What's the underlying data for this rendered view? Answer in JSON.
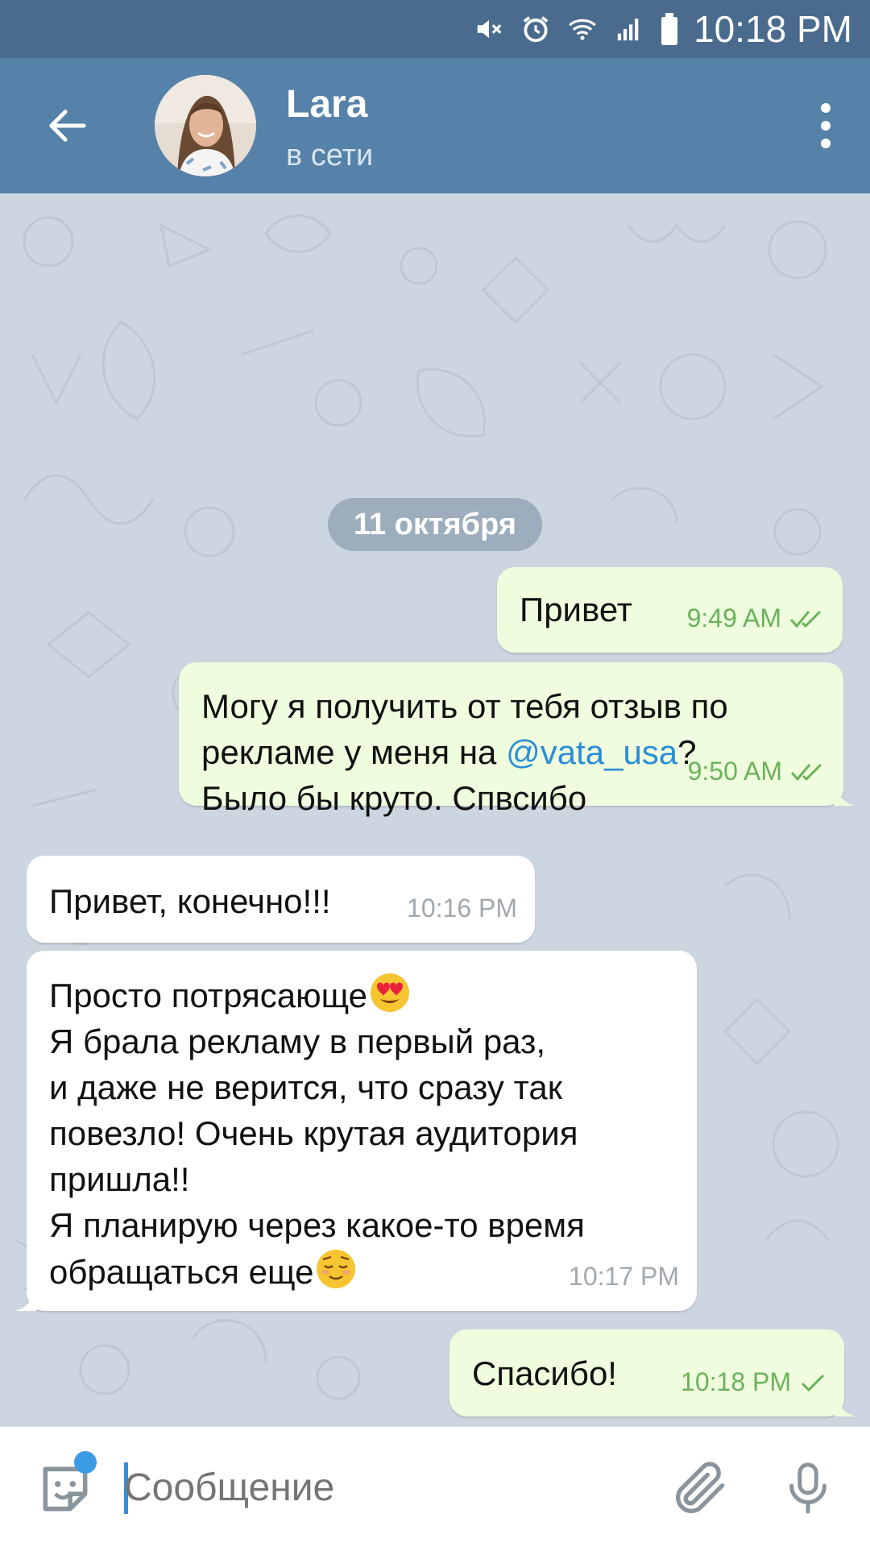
{
  "status_bar": {
    "time": "10:18 PM",
    "icons": [
      "mute-icon",
      "alarm-icon",
      "wifi-icon",
      "signal-icon",
      "battery-icon"
    ]
  },
  "header": {
    "contact_name": "Lara",
    "contact_status": "в сети",
    "back_icon": "arrow-left-icon",
    "menu_icon": "more-vertical-icon"
  },
  "chat": {
    "date_separator": "11 октября",
    "messages": [
      {
        "direction": "out",
        "text": "Привет",
        "time": "9:49 AM",
        "status": "read"
      },
      {
        "direction": "out",
        "text_before": "Могу я получить от тебя отзыв по\nрекламе у меня на ",
        "mention": "@vata_usa",
        "text_after": "?\nБыло бы круто. Спвсибо",
        "time": "9:50 AM",
        "status": "read"
      },
      {
        "direction": "in",
        "text": "Привет, конечно!!!",
        "time": "10:16 PM"
      },
      {
        "direction": "in",
        "text_line1": "Просто потрясающе",
        "emoji1": "heart-eyes-emoji",
        "text_middle": "Я брала рекламу в первый раз,\nи даже не верится, что сразу так\nповезло! Очень крутая аудитория\nпришла!!\nЯ планирую через какое-то время\nобращаться еще",
        "emoji2": "relieved-emoji",
        "time": "10:17 PM"
      },
      {
        "direction": "out",
        "text": "Спасибо!",
        "time": "10:18 PM",
        "status": "sent"
      }
    ]
  },
  "input_bar": {
    "placeholder": "Сообщение",
    "sticker_icon": "sticker-icon",
    "attach_icon": "paperclip-icon",
    "mic_icon": "microphone-icon"
  },
  "colors": {
    "status_bar": "#4a6b8d",
    "header": "#5681a8",
    "chat_background": "#ccd6e0",
    "outgoing_bubble": "#effdde",
    "incoming_bubble": "#ffffff",
    "outgoing_meta": "#6ab25a",
    "mention": "#2b8ed6"
  }
}
